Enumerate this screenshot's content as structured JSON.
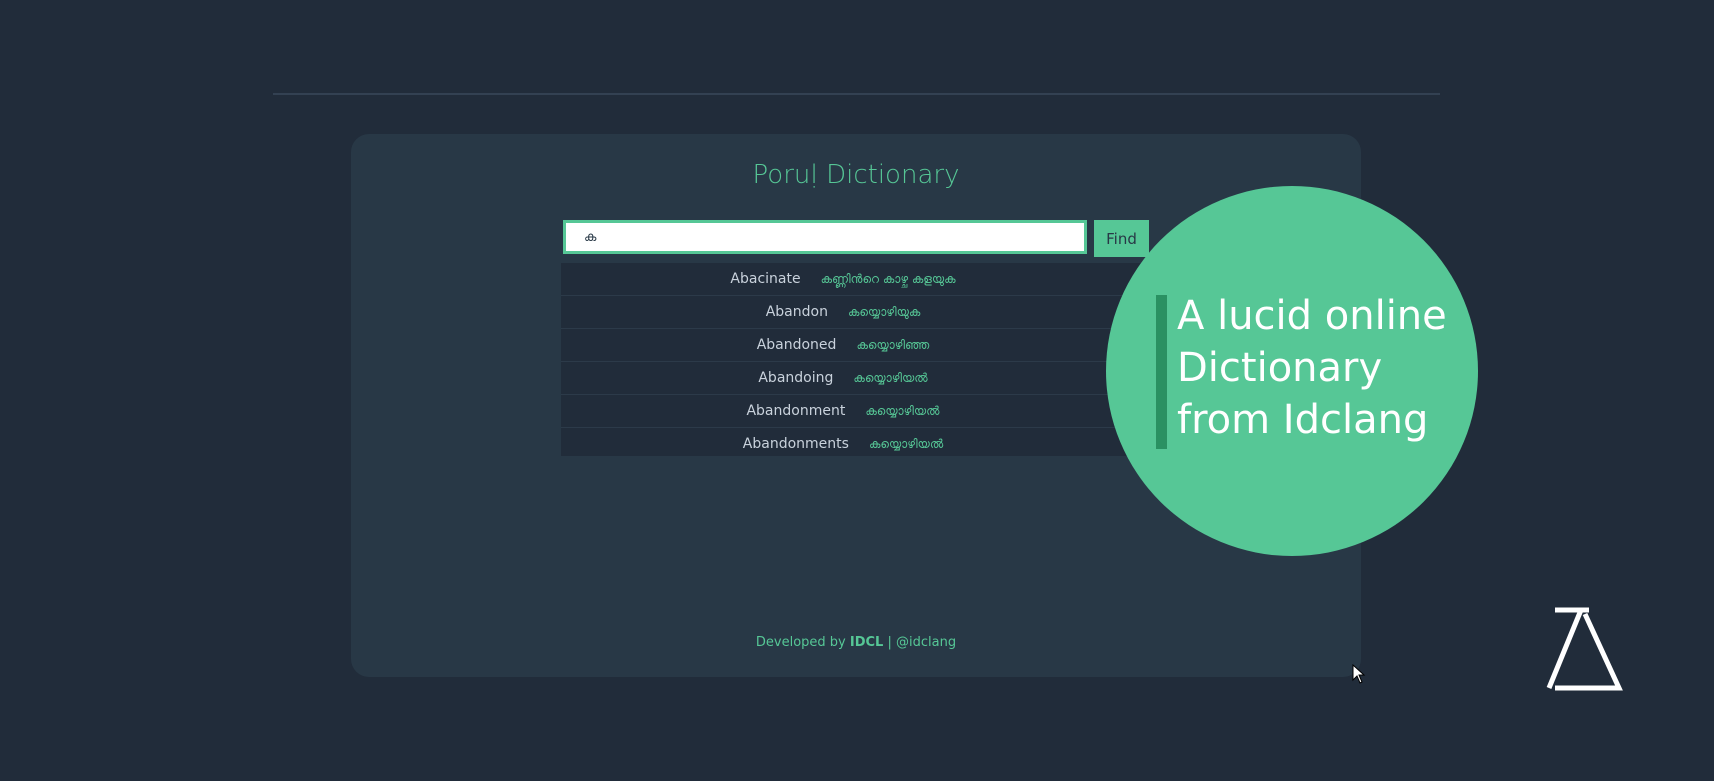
{
  "header": {
    "title": "Poruḷ Dictionary"
  },
  "search": {
    "value": "ക",
    "button_label": "Find"
  },
  "results": [
    {
      "word": "Abacinate",
      "meaning": "കണ്ണിൻറെ കാഴ്ച കളയുക"
    },
    {
      "word": "Abandon",
      "meaning": "കയ്യൊഴിയുക"
    },
    {
      "word": "Abandoned",
      "meaning": "കയ്യൊഴിഞ്ഞ"
    },
    {
      "word": "Abandoing",
      "meaning": "കയ്യൊഴിയൽ"
    },
    {
      "word": "Abandonment",
      "meaning": "കയ്യൊഴിയൽ"
    },
    {
      "word": "Abandonments",
      "meaning": "കയ്യൊഴിയൽ"
    }
  ],
  "footer": {
    "prefix": "Developed by",
    "brand": "IDCL",
    "separator": "|",
    "handle": "@idclang"
  },
  "promo": {
    "tagline": "A lucid online Dictionary from Idclang"
  },
  "colors": {
    "background": "#212c3a",
    "card": "#283846",
    "accent": "#56c796",
    "accent_dark": "#2a9162",
    "text_light": "#c9d2dc"
  },
  "icons": {
    "logo": "lambda-logo",
    "cursor": "mouse-pointer-icon"
  }
}
